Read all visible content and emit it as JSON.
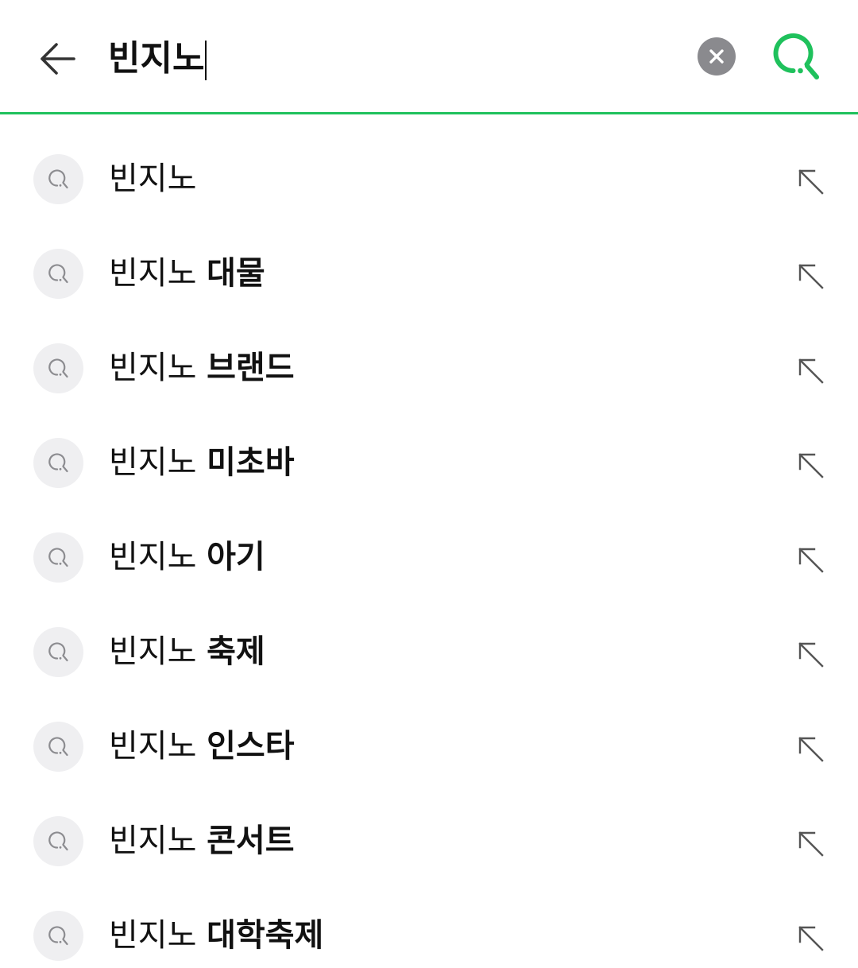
{
  "search": {
    "query": "빈지노",
    "back_icon": "arrow-left-icon",
    "clear_icon": "close-circle-icon",
    "submit_icon": "search-icon",
    "accent_color": "#1fc15c",
    "clear_bg_color": "#8a8a8e"
  },
  "suggestions": [
    {
      "prefix": "빈지노",
      "suffix": ""
    },
    {
      "prefix": "빈지노",
      "suffix": "대물"
    },
    {
      "prefix": "빈지노",
      "suffix": "브랜드"
    },
    {
      "prefix": "빈지노",
      "suffix": "미초바"
    },
    {
      "prefix": "빈지노",
      "suffix": "아기"
    },
    {
      "prefix": "빈지노",
      "suffix": "축제"
    },
    {
      "prefix": "빈지노",
      "suffix": "인스타"
    },
    {
      "prefix": "빈지노",
      "suffix": "콘서트"
    },
    {
      "prefix": "빈지노",
      "suffix": "대학축제"
    }
  ],
  "suggestion_icons": {
    "leading": "search-icon",
    "trailing": "arrow-up-left-icon"
  }
}
